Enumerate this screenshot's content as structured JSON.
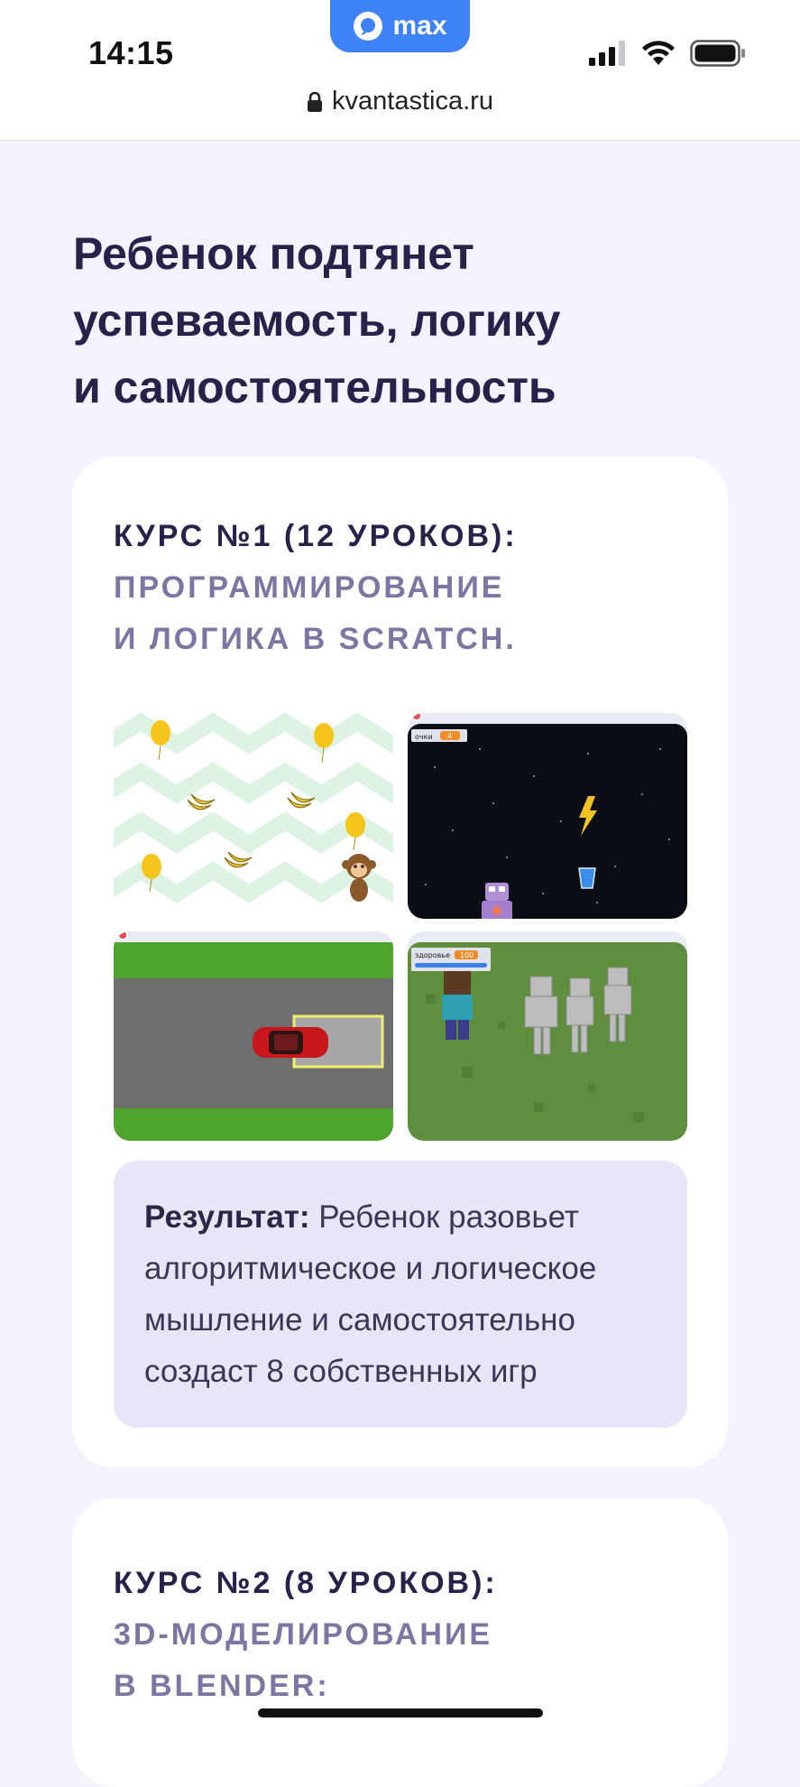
{
  "status_bar": {
    "time": "14:15",
    "max_label": "max"
  },
  "browser": {
    "url": "kvantastica.ru"
  },
  "headline": {
    "line1": "Ребенок подтянет",
    "line2": "успеваемость, логику",
    "line3": "и самостоятельность"
  },
  "course1": {
    "title_line1": "КУРС №1 (12 УРОКОВ):",
    "title_line2": "ПРОГРАММИРОВАНИЕ",
    "title_line3": "И ЛОГИКА В SCRATCH.",
    "games": {
      "space_score_label": "очки",
      "space_score_value": "4",
      "minecraft_health_label": "здоровье",
      "minecraft_health_value": "100"
    },
    "result_label": "Результат:",
    "result_line1": "Ребенок разовьет",
    "result_line2": "алгоритмическое и логическое",
    "result_line3": "мышление и самостоятельно",
    "result_line4": "создаст 8 собственных игр"
  },
  "course2": {
    "title_line1": "КУРС №2 (8 УРОКОВ):",
    "title_line2": "3D-МОДЕЛИРОВАНИЕ",
    "title_line3": "В BLENDER:"
  },
  "colors": {
    "page_bg": "#f3f2fd",
    "heading": "#26224a",
    "subtitle_gray": "#7c76a3",
    "result_bg": "#e7e6f6",
    "max_blue": "#3d82f6"
  }
}
